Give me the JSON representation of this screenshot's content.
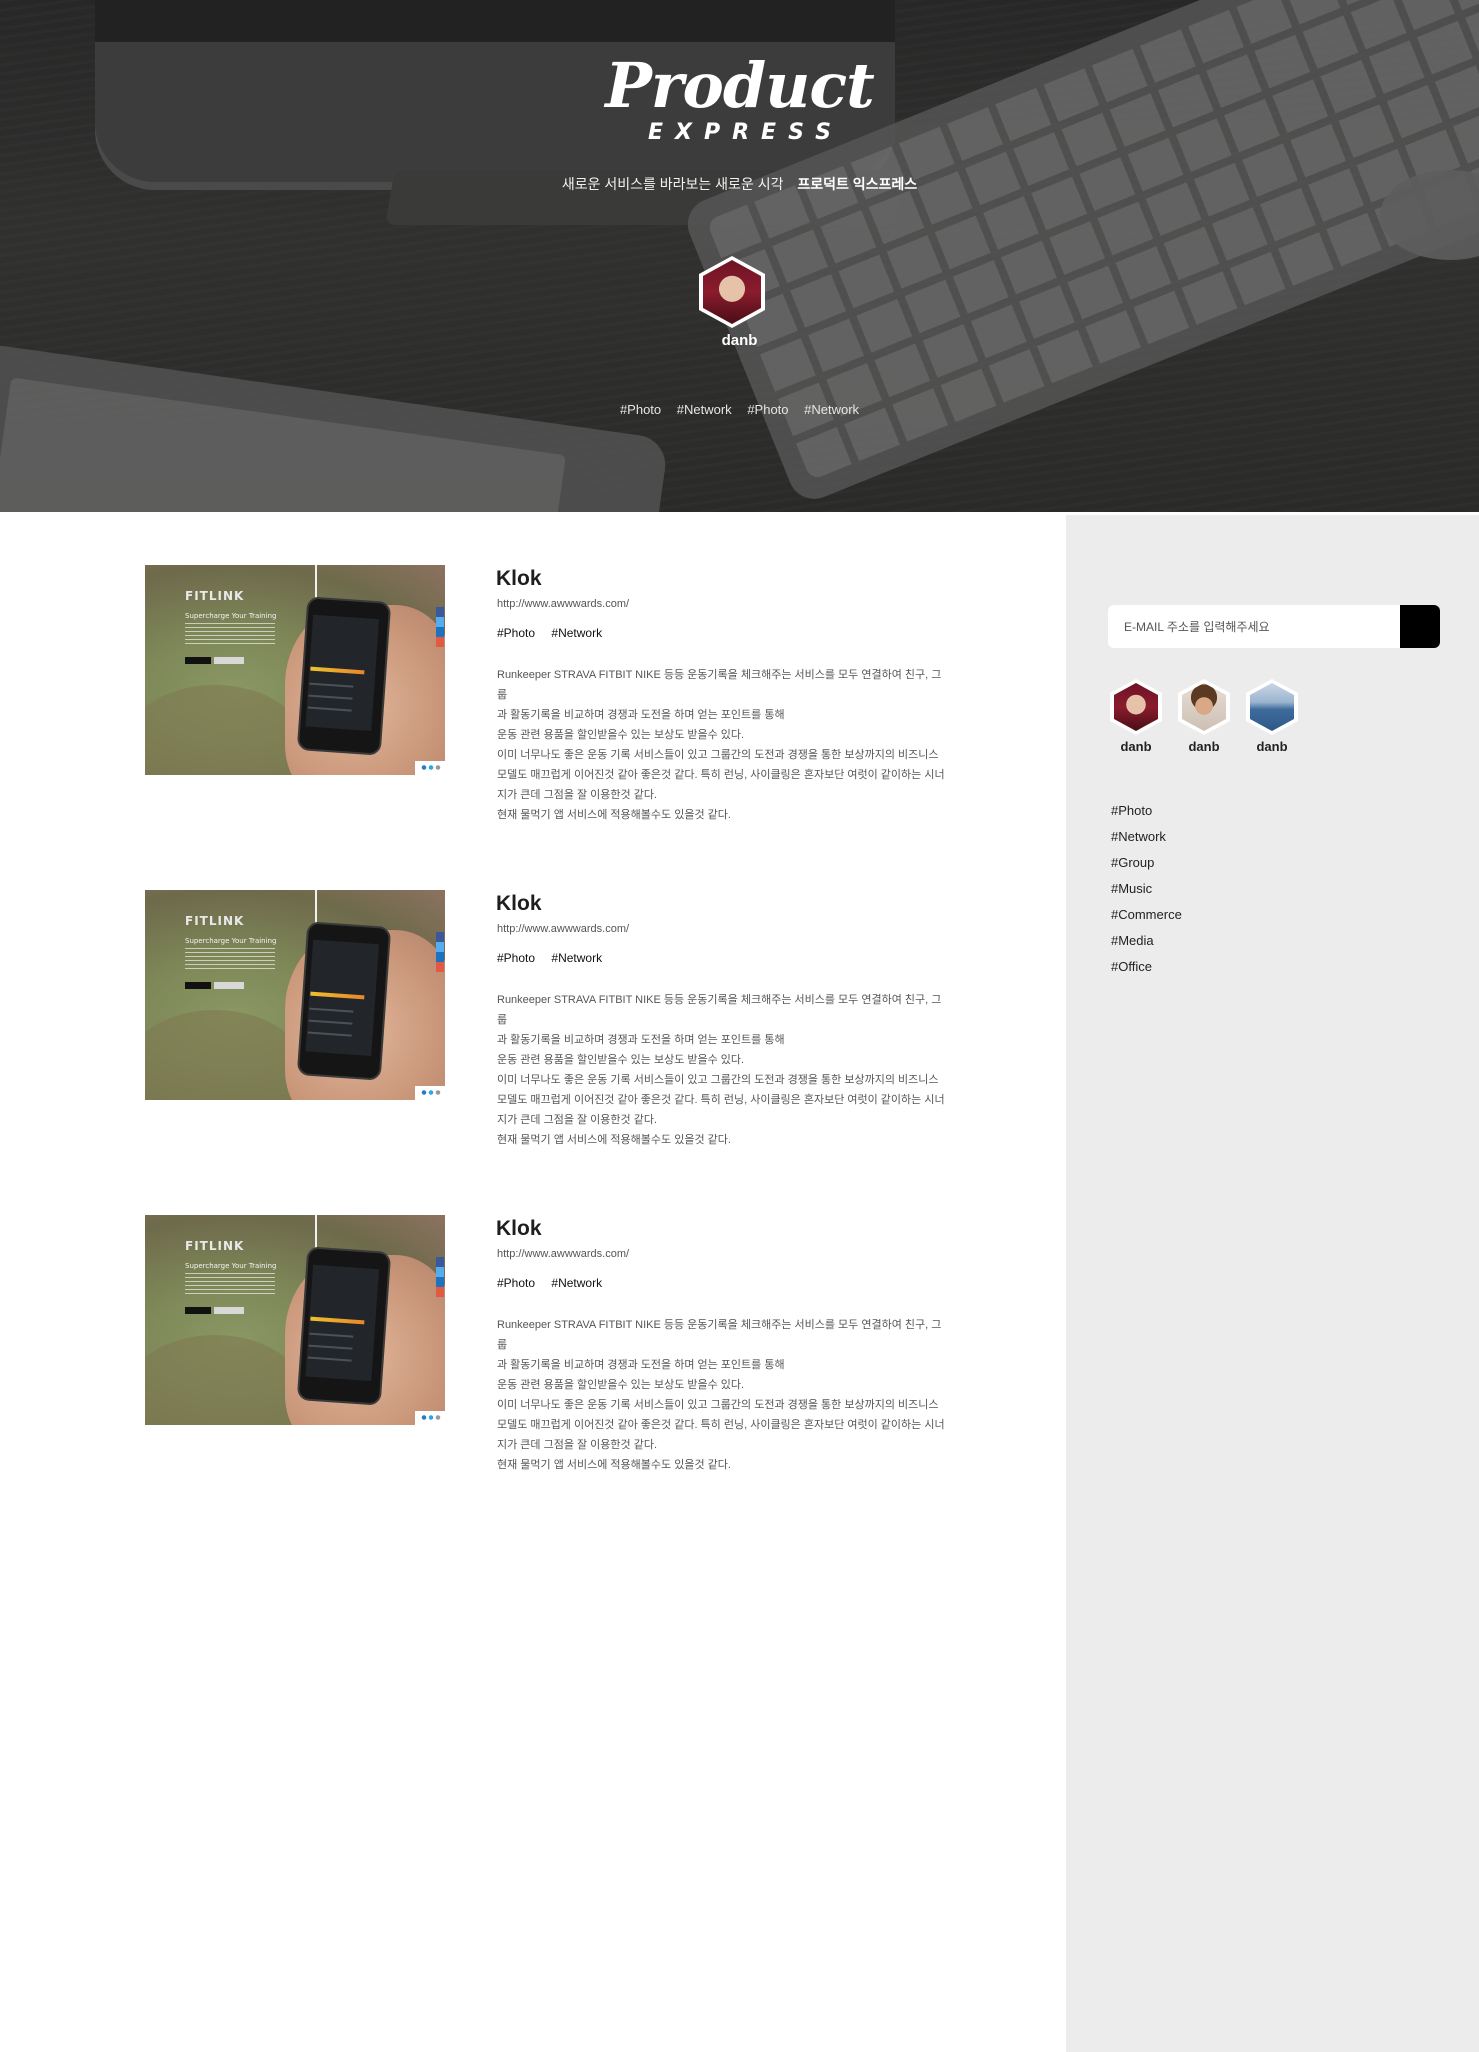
{
  "hero": {
    "brand_title": "Product",
    "brand_subtitle": "EXPRESS",
    "tagline_text": "새로운 서비스를 바라보는 새로운 시각",
    "tagline_bold": "프로덕트 익스프레스",
    "author_name": "danb",
    "tags": [
      "#Photo",
      "#Network",
      "#Photo",
      "#Network"
    ]
  },
  "posts": [
    {
      "title": "Klok",
      "url": "http://www.awwwards.com/",
      "tags": [
        "#Photo",
        "#Network"
      ],
      "body": [
        "Runkeeper STRAVA FITBIT NIKE 등등 운동기록을 체크해주는 서비스를 모두 연결하여 친구, 그룹",
        "과 활동기록을 비교하며 경쟁과 도전을 하며 얻는 포인트를 통해",
        "운동 관련 용품을 할인받을수 있는 보상도 받을수 있다.",
        "이미 너무나도 좋은 운동 기록 서비스들이 있고 그룹간의 도전과 경쟁을 통한 보상까지의 비즈니스",
        "모델도 매끄럽게 이어진것 같아 좋은것 같다. 특히 런닝, 사이클링은 혼자보단 여럿이 같이하는 시너",
        "지가 큰데 그점을 잘 이용한것 같다.",
        "현재 물먹기 앱 서비스에 적용해볼수도 있을것 같다."
      ],
      "thumb": {
        "logo": "FITLINK",
        "tagline": "Supercharge Your Training"
      }
    },
    {
      "title": "Klok",
      "url": "http://www.awwwards.com/",
      "tags": [
        "#Photo",
        "#Network"
      ],
      "body": [
        "Runkeeper STRAVA FITBIT NIKE 등등 운동기록을 체크해주는 서비스를 모두 연결하여 친구, 그룹",
        "과 활동기록을 비교하며 경쟁과 도전을 하며 얻는 포인트를 통해",
        "운동 관련 용품을 할인받을수 있는 보상도 받을수 있다.",
        "이미 너무나도 좋은 운동 기록 서비스들이 있고 그룹간의 도전과 경쟁을 통한 보상까지의 비즈니스",
        "모델도 매끄럽게 이어진것 같아 좋은것 같다. 특히 런닝, 사이클링은 혼자보단 여럿이 같이하는 시너",
        "지가 큰데 그점을 잘 이용한것 같다.",
        "현재 물먹기 앱 서비스에 적용해볼수도 있을것 같다."
      ],
      "thumb": {
        "logo": "FITLINK",
        "tagline": "Supercharge Your Training"
      }
    },
    {
      "title": "Klok",
      "url": "http://www.awwwards.com/",
      "tags": [
        "#Photo",
        "#Network"
      ],
      "body": [
        "Runkeeper STRAVA FITBIT NIKE 등등 운동기록을 체크해주는 서비스를 모두 연결하여 친구, 그룹",
        "과 활동기록을 비교하며 경쟁과 도전을 하며 얻는 포인트를 통해",
        "운동 관련 용품을 할인받을수 있는 보상도 받을수 있다.",
        "이미 너무나도 좋은 운동 기록 서비스들이 있고 그룹간의 도전과 경쟁을 통한 보상까지의 비즈니스",
        "모델도 매끄럽게 이어진것 같아 좋은것 같다. 특히 런닝, 사이클링은 혼자보단 여럿이 같이하는 시너",
        "지가 큰데 그점을 잘 이용한것 같다.",
        "현재 물먹기 앱 서비스에 적용해볼수도 있을것 같다."
      ],
      "thumb": {
        "logo": "FITLINK",
        "tagline": "Supercharge Your Training"
      }
    }
  ],
  "sidebar": {
    "email_placeholder": "E-MAIL 주소를 입력해주세요",
    "members": [
      {
        "name": "danb",
        "avatar": "woman-avatar"
      },
      {
        "name": "danb",
        "avatar": "man-avatar"
      },
      {
        "name": "danb",
        "avatar": "sea-avatar"
      }
    ],
    "tags": [
      "#Photo",
      "#Network",
      "#Group",
      "#Music",
      "#Commerce",
      "#Media",
      "#Office"
    ]
  },
  "colors": {
    "sidebar_bg": "#ececec",
    "submit_button": "#000000",
    "hero_overlay": "#2b2b2b"
  }
}
